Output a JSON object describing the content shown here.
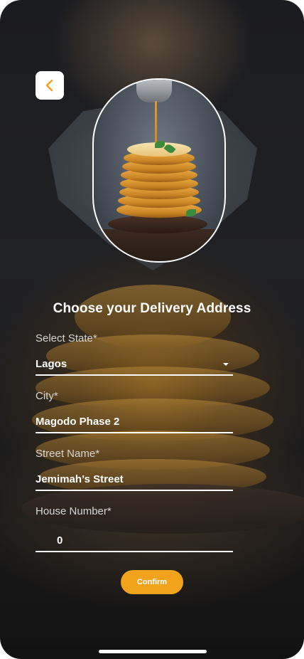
{
  "back": {
    "icon": "chevron-left-icon",
    "color": "#f2a31c"
  },
  "hero": {
    "image": "pancake-stack-with-syrup"
  },
  "form": {
    "title": "Choose your Delivery Address",
    "state": {
      "label": "Select State*",
      "value": "Lagos",
      "icon": "caret-down-icon"
    },
    "city": {
      "label": "City*",
      "value": "Magodo Phase 2"
    },
    "street": {
      "label": "Street Name*",
      "value": "Jemimah’s Street"
    },
    "house": {
      "label": "House Number*",
      "value": "0"
    },
    "confirm_label": "Confirm"
  },
  "colors": {
    "accent": "#f2a31c",
    "text": "#ffffff",
    "label": "#d5d5d5"
  }
}
